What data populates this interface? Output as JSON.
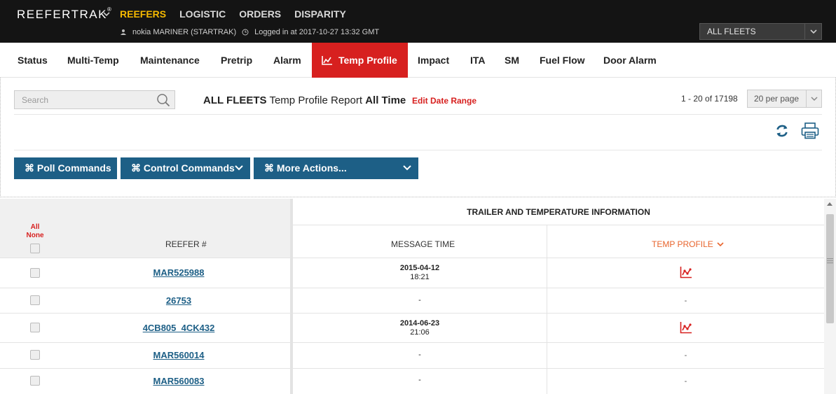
{
  "app": {
    "brand": "REEFERTRAK",
    "brand_mark": "®",
    "nav": [
      "REEFERS",
      "LOGISTIC",
      "ORDERS",
      "DISPARITY"
    ],
    "user": "nokia MARINER (STARTRAK)",
    "login": "Logged in at 2017-10-27 13:32 GMT",
    "fleet_selected": "ALL FLEETS"
  },
  "tabs": [
    "Status",
    "Multi-Temp",
    "Maintenance",
    "Pretrip",
    "Alarm",
    "Temp Profile",
    "Impact",
    "ITA",
    "SM",
    "Fuel Flow",
    "Door Alarm"
  ],
  "toolbar": {
    "search_placeholder": "Search",
    "title_fleet": "ALL FLEETS",
    "title_report": "Temp Profile Report",
    "title_range": "All Time",
    "edit_range": "Edit Date Range",
    "count": "1 - 20 of 17198",
    "per_page": "20 per page",
    "poll_commands": "⌘ Poll Commands",
    "control_commands": "⌘ Control Commands",
    "more_actions": "⌘ More Actions..."
  },
  "table": {
    "group_header": "TRAILER AND TEMPERATURE INFORMATION",
    "all": "All",
    "none": "None",
    "col_reefer": "REEFER #",
    "col_message_time": "MESSAGE TIME",
    "col_temp_profile": "TEMP PROFILE",
    "rows": [
      {
        "reefer": "MAR525988",
        "date": "2015-04-12",
        "time": "18:21",
        "profile": "chart"
      },
      {
        "reefer": "26753",
        "date": "-",
        "time": "",
        "profile": "-"
      },
      {
        "reefer": "4CB805_4CK432",
        "date": "2014-06-23",
        "time": "21:06",
        "profile": "chart"
      },
      {
        "reefer": "MAR560014",
        "date": "-",
        "time": "",
        "profile": "-"
      },
      {
        "reefer": "MAR560083",
        "date": "-",
        "time": "",
        "profile": "-"
      }
    ]
  },
  "colors": {
    "accent_red": "#d7201f",
    "nav_active": "#f5b900",
    "button_blue": "#1d5f86",
    "topbar": "#141414",
    "temp_profile_header": "#e8642c"
  },
  "icons": {
    "user": "user-icon",
    "clock": "clock-icon",
    "search": "search-icon",
    "refresh": "refresh-icon",
    "print": "printer-icon",
    "chart": "line-chart-icon"
  }
}
